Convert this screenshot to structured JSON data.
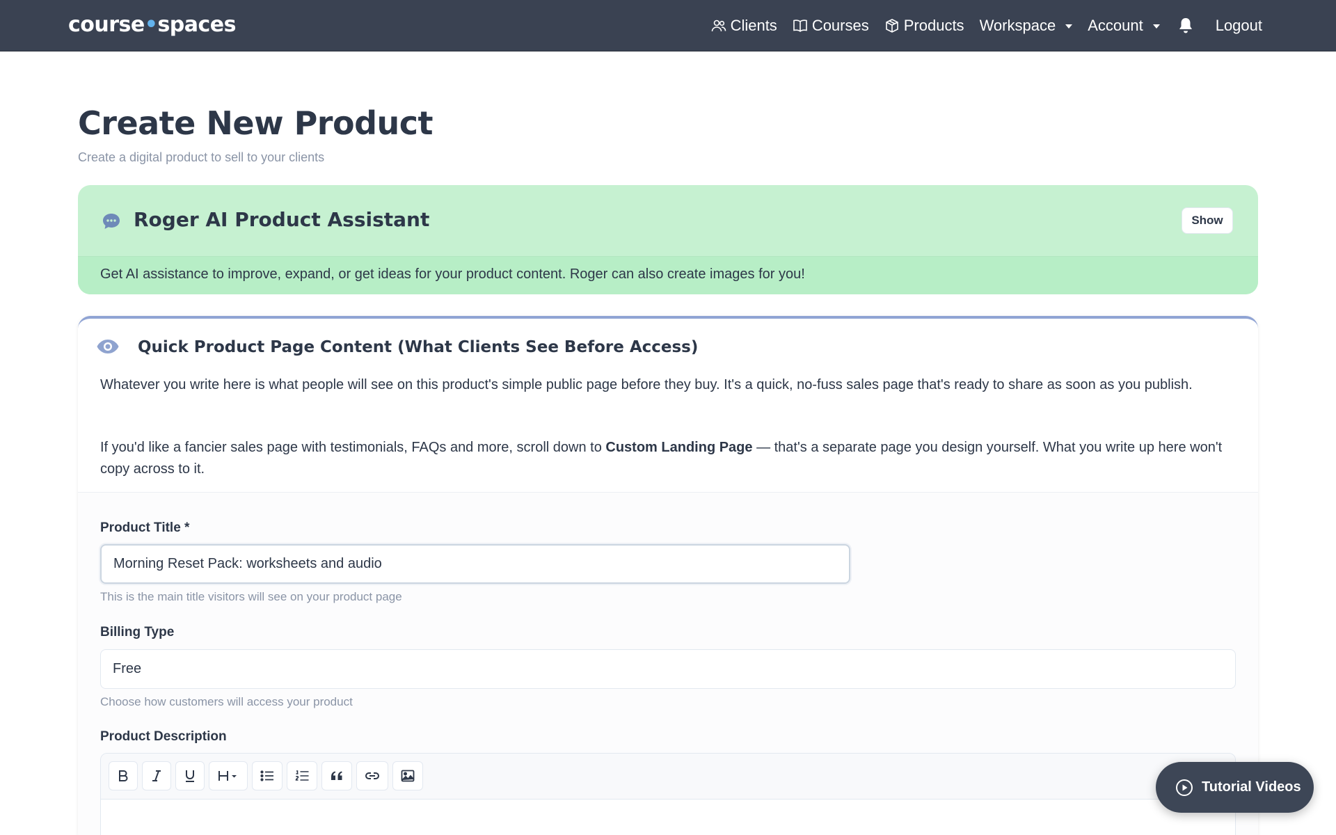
{
  "navbar": {
    "brand_left": "course",
    "brand_dot": "•",
    "brand_right": "spaces",
    "items": [
      {
        "label": "Clients",
        "icon": "users-icon"
      },
      {
        "label": "Courses",
        "icon": "book-icon"
      },
      {
        "label": "Products",
        "icon": "box-icon"
      },
      {
        "label": "Workspace",
        "icon": "chevron-down-icon"
      },
      {
        "label": "Account",
        "icon": "chevron-down-icon"
      }
    ],
    "bell_icon": "bell-icon",
    "logout_label": "Logout"
  },
  "page": {
    "title": "Create New Product",
    "subtitle": "Create a digital product to sell to your clients"
  },
  "ai_card": {
    "title": "Roger AI Product Assistant",
    "show_label": "Show",
    "description": "Get AI assistance to improve, expand, or get ideas for your product content. Roger can also create images for you!",
    "icon": "chat-bubble-icon"
  },
  "quick_section": {
    "title": "Quick Product Page Content (What Clients See Before Access)",
    "icon": "eye-icon",
    "para1": "Whatever you write here is what people will see on this product's simple public page before they buy. It's a quick, no-fuss sales page that's ready to share as soon as you publish.",
    "para2_before": "If you'd like a fancier sales page with testimonials, FAQs and more, scroll down to ",
    "para2_bold": "Custom Landing Page",
    "para2_after": " — that's a separate page you design yourself. What you write up here won't copy across to it."
  },
  "form": {
    "title_label": "Product Title *",
    "title_value": "Morning Reset Pack: worksheets and audio",
    "title_help": "This is the main title visitors will see on your product page",
    "billing_label": "Billing Type",
    "billing_value": "Free",
    "billing_help": "Choose how customers will access your product",
    "description_label": "Product Description",
    "toolbar": [
      "bold-icon",
      "italic-icon",
      "underline-icon",
      "heading-icon",
      "bullet-list-icon",
      "numbered-list-icon",
      "quote-icon",
      "link-icon",
      "image-icon"
    ]
  },
  "tutorial": {
    "label": "Tutorial Videos",
    "icon": "play-circle-icon"
  },
  "colors": {
    "navbar_bg": "#3a4252",
    "ai_card_bg": "#c6f1d1",
    "section_accent": "#90a4d4",
    "brand_dot": "#63b3ed"
  }
}
